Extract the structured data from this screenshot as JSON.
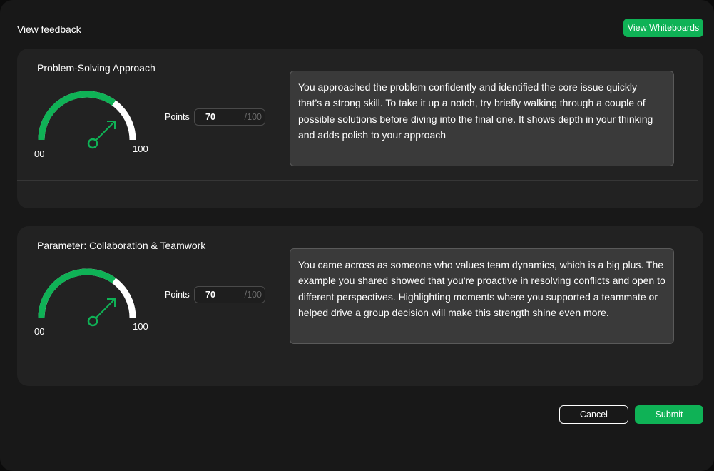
{
  "modal": {
    "title": "View feedback",
    "view_whiteboards_label": "View Whiteboards"
  },
  "parameters": [
    {
      "title": "Problem-Solving Approach",
      "gauge_min_label": "00",
      "gauge_max_label": "100",
      "points_label": "Points",
      "points_value": "70",
      "points_max": "/100",
      "score_fraction": 0.7,
      "feedback": "You approached the problem confidently and identified the core issue quickly—that’s a strong skill. To take it up a notch, try briefly walking through a couple of possible solutions before diving into the final one. It shows depth in your thinking and adds polish to your approach"
    },
    {
      "title": "Parameter: Collaboration & Teamwork",
      "gauge_min_label": "00",
      "gauge_max_label": "100",
      "points_label": "Points",
      "points_value": "70",
      "points_max": "/100",
      "score_fraction": 0.7,
      "feedback": "You came across as someone who values team dynamics, which is a big plus. The example you shared showed that you're proactive in resolving conflicts and open to different perspectives. Highlighting moments where you supported a teammate or helped drive a group decision will make this strength shine even more."
    }
  ],
  "footer": {
    "cancel_label": "Cancel",
    "submit_label": "Submit"
  },
  "colors": {
    "accent": "#0fb256",
    "background": "#181818",
    "card": "#222222",
    "feedback_box": "#3a3a3a"
  },
  "icons": {
    "gauge_needle": "arrow-up-right-icon"
  }
}
